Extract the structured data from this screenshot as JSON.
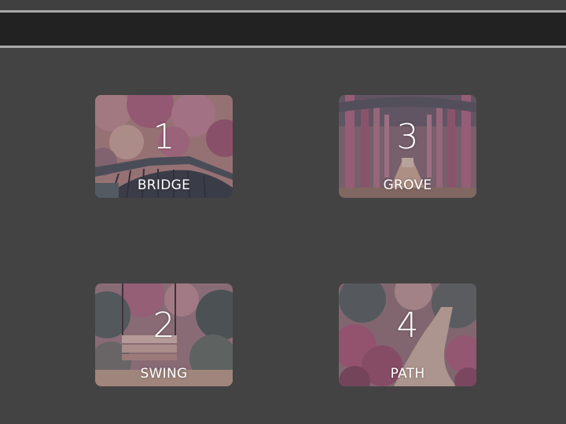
{
  "gallery": {
    "tiles": [
      {
        "number": "1",
        "label": "BRIDGE"
      },
      {
        "number": "2",
        "label": "SWING"
      },
      {
        "number": "3",
        "label": "GROVE"
      },
      {
        "number": "4",
        "label": "PATH"
      }
    ]
  }
}
